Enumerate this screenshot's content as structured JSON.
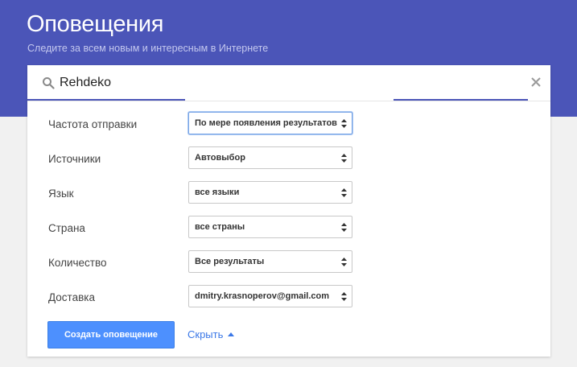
{
  "header": {
    "title": "Оповещения",
    "subtitle": "Следите за всем новым и интересным в Интернете"
  },
  "search": {
    "value": "Rehdeko",
    "icon": "search-icon",
    "clear_icon": "close-icon"
  },
  "options": [
    {
      "label": "Частота отправки",
      "value": "По мере появления результатов"
    },
    {
      "label": "Источники",
      "value": "Автовыбор"
    },
    {
      "label": "Язык",
      "value": "все языки"
    },
    {
      "label": "Страна",
      "value": "все страны"
    },
    {
      "label": "Количество",
      "value": "Все результаты"
    },
    {
      "label": "Доставка",
      "value": "dmitry.krasnoperov@gmail.com"
    }
  ],
  "actions": {
    "create_label": "Создать оповещение",
    "hide_label": "Скрыть"
  },
  "colors": {
    "header_bg": "#4b55b8",
    "primary_button": "#4d90fe",
    "link": "#3b78e7"
  }
}
